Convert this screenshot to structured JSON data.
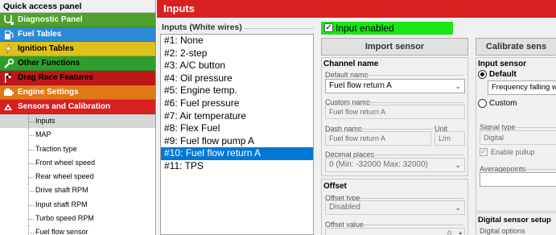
{
  "left_panel": {
    "title": "Quick access panel",
    "categories": [
      {
        "label": "Diagnostic Panel",
        "icon": "stethoscope-icon"
      },
      {
        "label": "Fuel Tables",
        "icon": "fuel-icon"
      },
      {
        "label": "Ignition Tables",
        "icon": "spark-icon"
      },
      {
        "label": "Other Functions",
        "icon": "wrench-icon"
      },
      {
        "label": "Drag Race Features",
        "icon": "flag-icon"
      },
      {
        "label": "Engine Settings",
        "icon": "engine-icon"
      },
      {
        "label": "Sensors and Calibration",
        "icon": "sensor-icon"
      }
    ],
    "sensor_items": [
      "Inputs",
      "MAP",
      "Traction type",
      "Front wheel speed",
      "Rear wheel speed",
      "Drive shaft RPM",
      "Input shaft RPM",
      "Turbo speed RPM",
      "Fuel flow sensor"
    ],
    "selected_item": "Inputs"
  },
  "main": {
    "title": "Inputs",
    "inputs_group_label": "Inputs (White wires)",
    "inputs": [
      "#1: None",
      "#2: 2-step",
      "#3: A/C button",
      "#4: Oil pressure",
      "#5: Engine temp.",
      "#6: Fuel pressure",
      "#7: Air temperature",
      "#8: Flex Fuel",
      "#9: Fuel flow pump A",
      "#10: Fuel flow return A",
      "#11: TPS"
    ],
    "selected_input": "#10: Fuel flow return A",
    "input_enabled_label": "Input enabled",
    "import_button": "Import sensor",
    "calibrate_button": "Calibrate sens",
    "channel_name": {
      "title": "Channel name",
      "default_name_label": "Default name",
      "default_name_value": "Fuel flow return A",
      "custom_name_label": "Custom name",
      "custom_name_value": "Fuel flow return A",
      "dash_name_label": "Dash name",
      "dash_name_value": "Fuel flow return A",
      "unit_label": "Unit",
      "unit_value": "L/m",
      "decimal_label": "Decimal places",
      "decimal_value": "0 (Min: -32000  Max: 32000)"
    },
    "offset": {
      "title": "Offset",
      "type_label": "Offset type",
      "type_value": "Disabled",
      "value_label": "Offset value",
      "value": "0"
    },
    "input_sensor": {
      "title": "Input sensor",
      "default_label": "Default",
      "default_value": "Frequency falling w",
      "custom_label": "Custom",
      "signal_type_label": "Signal type",
      "signal_type_value": "Digital",
      "pullup_label": "Enable pullup",
      "averagepoints_label": "Averagepoints",
      "averagepoints_value": ""
    },
    "digital_setup": {
      "title": "Digital sensor setup",
      "options_label": "Digital options"
    }
  },
  "colors": {
    "header_red": "#d8201e",
    "enabled_green": "#17e617",
    "selection_blue": "#0078d7"
  }
}
